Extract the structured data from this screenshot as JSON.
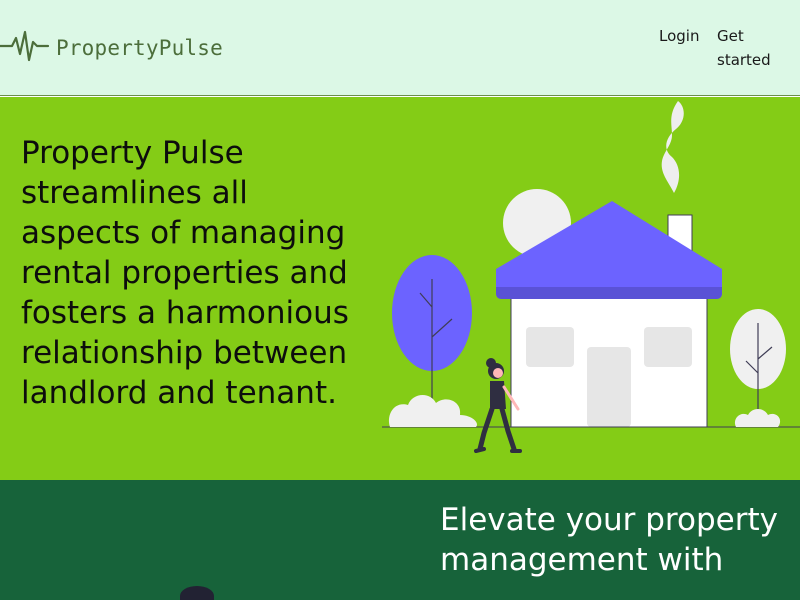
{
  "header": {
    "brand": "PropertyPulse",
    "nav": {
      "login": "Login",
      "get_started": "Get started"
    }
  },
  "hero": {
    "headline": "Property Pulse streamlines all aspects of managing rental properties and fosters a harmonious relationship between landlord and tenant."
  },
  "section2": {
    "headline": "Elevate your property management with"
  },
  "colors": {
    "header_bg": "#dcf8e6",
    "hero_bg": "#84cc16",
    "band_bg": "#17633a",
    "accent": "#6c63ff"
  },
  "icons": {
    "logo": "pulse-line-icon"
  }
}
